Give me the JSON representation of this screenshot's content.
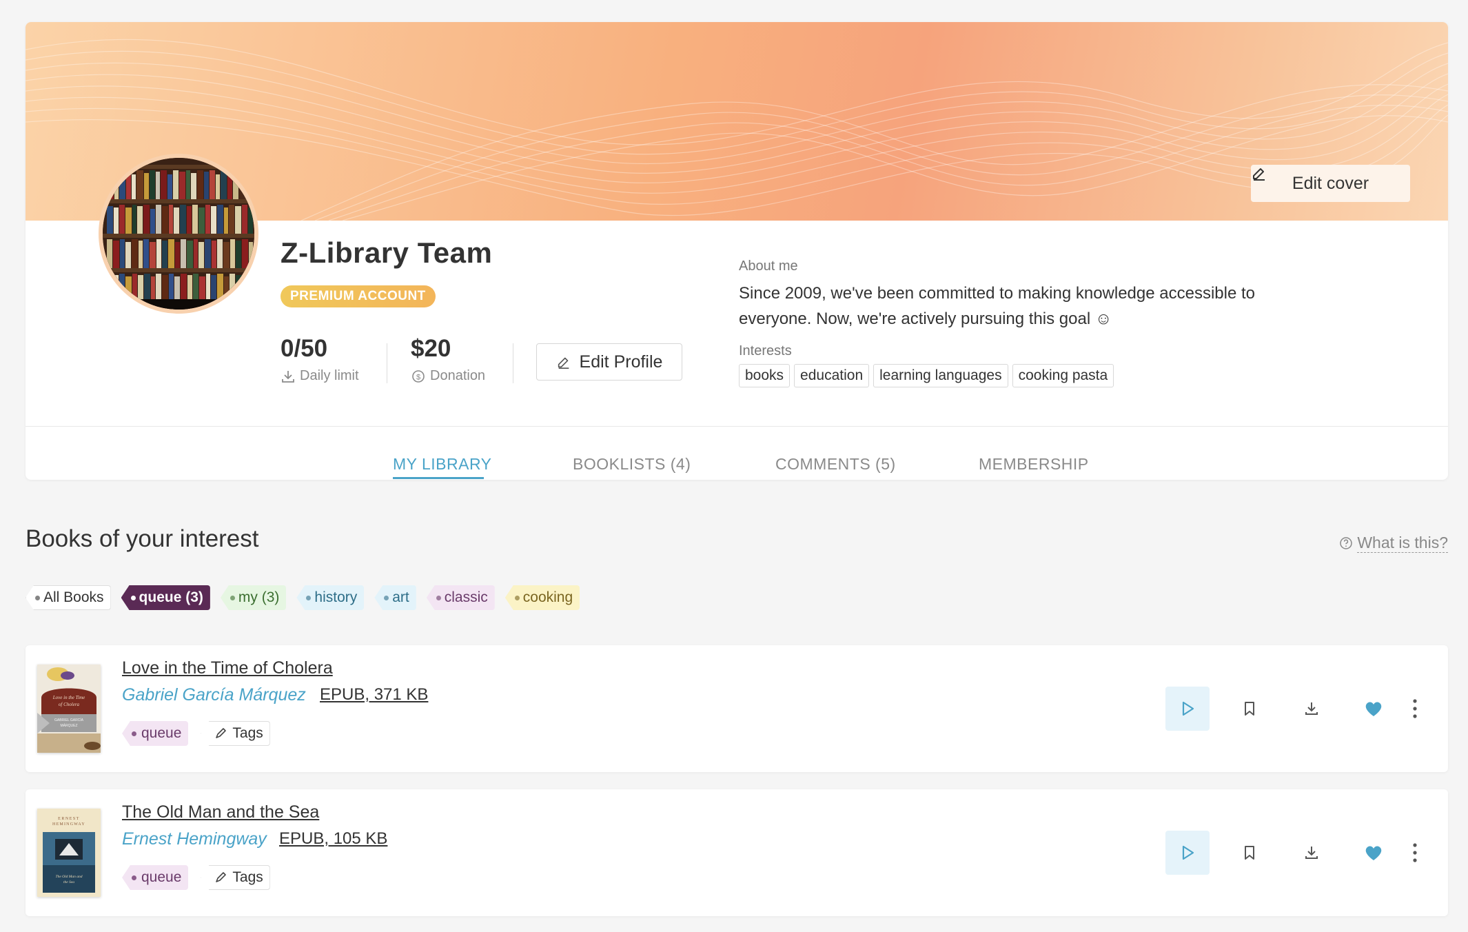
{
  "cover": {
    "edit_label": "Edit cover"
  },
  "profile": {
    "name": "Z-Library Team",
    "badge": "PREMIUM ACCOUNT",
    "stats": [
      {
        "value": "0/50",
        "label": "Daily limit",
        "icon": "download-icon"
      },
      {
        "value": "$20",
        "label": "Donation",
        "icon": "dollar-circle-icon"
      }
    ],
    "edit_label": "Edit Profile",
    "about_label": "About me",
    "about_text": "Since 2009, we've been committed to making knowledge accessible to everyone. Now, we're actively pursuing this goal ☺",
    "interests_label": "Interests",
    "interests": [
      "books",
      "education",
      "learning languages",
      "cooking pasta"
    ]
  },
  "tabs": [
    {
      "label": "MY LIBRARY",
      "active": true
    },
    {
      "label": "BOOKLISTS (4)",
      "active": false
    },
    {
      "label": "COMMENTS (5)",
      "active": false
    },
    {
      "label": "MEMBERSHIP",
      "active": false
    }
  ],
  "section": {
    "title": "Books of your interest",
    "help_label": "What is this?"
  },
  "filters": [
    "All Books",
    "queue (3)",
    "my (3)",
    "history",
    "art",
    "classic",
    "cooking"
  ],
  "books": [
    {
      "title": "Love in the Time of Cholera",
      "author": "Gabriel García Márquez",
      "format": "EPUB, 371 KB",
      "tags": [
        "queue",
        "Tags"
      ],
      "cover_text": [
        "Love in the Time",
        "of Cholera",
        "GABRIEL GARCÍA",
        "MÁRQUEZ"
      ]
    },
    {
      "title": "The Old Man and the Sea",
      "author": "Ernest Hemingway",
      "format": "EPUB, 105 KB",
      "tags": [
        "queue",
        "Tags"
      ],
      "cover_text": [
        "ERNEST",
        "HEMINGWAY",
        "The Old Man and",
        "the Sea"
      ]
    }
  ],
  "colors": {
    "accent": "#4aa3c8",
    "premium": "#f0c85a",
    "queue_active": "#5a2a55"
  }
}
